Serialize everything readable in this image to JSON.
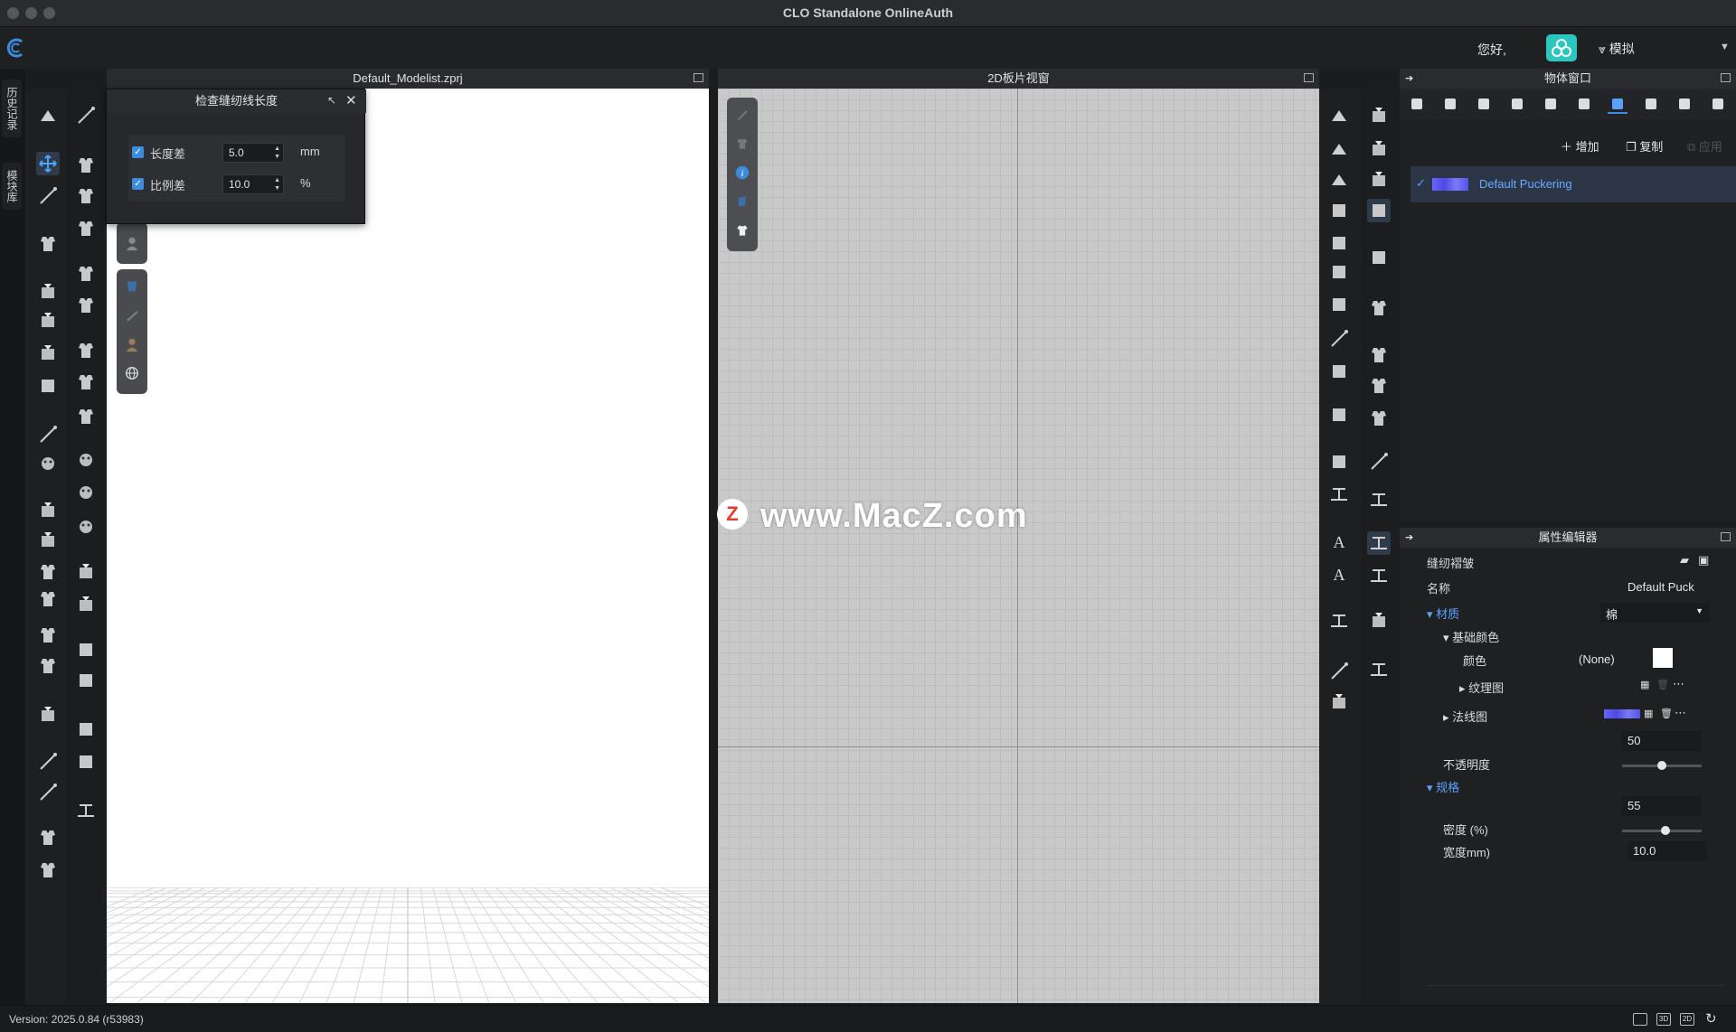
{
  "window": {
    "title": "CLO Standalone OnlineAuth"
  },
  "appbar": {
    "greeting": "您好,",
    "mode_label": "模拟"
  },
  "side_tabs": [
    "历史记录",
    "模块库"
  ],
  "panel_3d": {
    "title": "Default_Modelist.zprj"
  },
  "panel_2d": {
    "title": "2D板片视窗"
  },
  "dialog": {
    "title": "检查缝纫线长度",
    "rows": [
      {
        "label": "长度差",
        "value": "5.0",
        "unit": "mm",
        "checked": true
      },
      {
        "label": "比例差",
        "value": "10.0",
        "unit": "%",
        "checked": true
      }
    ]
  },
  "object_window": {
    "title": "物体窗口",
    "add_label": "增加",
    "copy_label": "复制",
    "apply_label": "应用",
    "items": [
      {
        "name": "Default Puckering",
        "selected": true
      }
    ]
  },
  "property_editor": {
    "title": "属性编辑器",
    "section_title": "缝纫褶皱",
    "name_label": "名称",
    "name_value": "Default Puck",
    "material_label": "材质",
    "material_value": "棉",
    "base_color_label": "基础颜色",
    "color_label": "颜色",
    "color_value": "(None)",
    "texture_label": "纹理图",
    "normal_label": "法线图",
    "opacity_label": "不透明度",
    "opacity_value": "50",
    "spec_label": "规格",
    "density_label": "密度 (%)",
    "density_value": "55",
    "width_label": "宽度mm)",
    "width_value": "10.0"
  },
  "status": {
    "version": "Version: 2025.0.84 (r53983)",
    "icons": [
      "",
      "3D",
      "2D",
      ""
    ]
  },
  "watermark": {
    "text": "www.MacZ.com",
    "badge": "Z"
  },
  "colors": {
    "accent": "#3c8dde",
    "panel": "#1f2022",
    "viewport2d": "#c9c9c9"
  }
}
